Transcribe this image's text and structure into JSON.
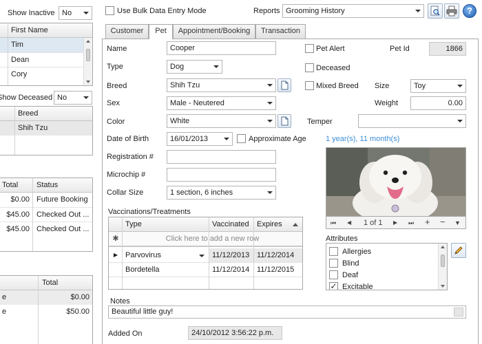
{
  "left": {
    "show_inactive_label": "Show Inactive",
    "show_inactive_value": "No",
    "owners_header": "First Name",
    "owners": [
      "Tim",
      "Dean",
      "Cory"
    ],
    "show_deceased_label": "Show Deceased",
    "show_deceased_value": "No",
    "pets_header": "Breed",
    "pets": [
      "Shih Tzu"
    ],
    "bookings_headers": [
      "Total",
      "Status"
    ],
    "bookings": [
      {
        "total": "$0.00",
        "status": "Future Booking"
      },
      {
        "total": "$45.00",
        "status": "Checked Out ..."
      },
      {
        "total": "$45.00",
        "status": "Checked Out ..."
      }
    ],
    "totals_header": "Total",
    "totals": [
      {
        "prefix": "e",
        "total": "$0.00"
      },
      {
        "prefix": "e",
        "total": "$50.00"
      }
    ]
  },
  "toolbar": {
    "bulk_label": "Use Bulk Data Entry Mode",
    "reports_label": "Reports",
    "reports_value": "Grooming History"
  },
  "tabs": [
    "Customer",
    "Pet",
    "Appointment/Booking",
    "Transaction"
  ],
  "pet": {
    "name_label": "Name",
    "name": "Cooper",
    "type_label": "Type",
    "type": "Dog",
    "breed_label": "Breed",
    "breed": "Shih Tzu",
    "sex_label": "Sex",
    "sex": "Male - Neutered",
    "color_label": "Color",
    "color": "White",
    "dob_label": "Date of Birth",
    "dob": "16/01/2013",
    "approx_age_label": "Approximate Age",
    "age_text": "1 year(s), 11 month(s)",
    "registration_label": "Registration #",
    "microchip_label": "Microchip #",
    "collar_label": "Collar Size",
    "collar": "1 section, 6 inches",
    "pet_alert_label": "Pet Alert",
    "deceased_label": "Deceased",
    "mixed_breed_label": "Mixed Breed",
    "pet_id_label": "Pet Id",
    "pet_id": "1866",
    "size_label": "Size",
    "size": "Toy",
    "weight_label": "Weight",
    "weight": "0.00",
    "temper_label": "Temper",
    "temper": ""
  },
  "vacc": {
    "title": "Vaccinations/Treatments",
    "headers": [
      "Type",
      "Vaccinated",
      "Expires"
    ],
    "new_row": "Click here to add a new row",
    "rows": [
      {
        "type": "Parvovirus",
        "vaccinated": "11/12/2013",
        "expires": "11/12/2014"
      },
      {
        "type": "Bordetella",
        "vaccinated": "11/12/2014",
        "expires": "11/12/2015"
      }
    ]
  },
  "photo_nav": {
    "page": "1 of 1"
  },
  "attributes": {
    "title": "Attributes",
    "items": [
      {
        "label": "Allergies",
        "checked": false
      },
      {
        "label": "Blind",
        "checked": false
      },
      {
        "label": "Deaf",
        "checked": false
      },
      {
        "label": "Excitable",
        "checked": true
      }
    ]
  },
  "notes": {
    "label": "Notes",
    "value": "Beautiful little guy!"
  },
  "added": {
    "label": "Added On",
    "value": "24/10/2012 3:56:22 p.m."
  }
}
